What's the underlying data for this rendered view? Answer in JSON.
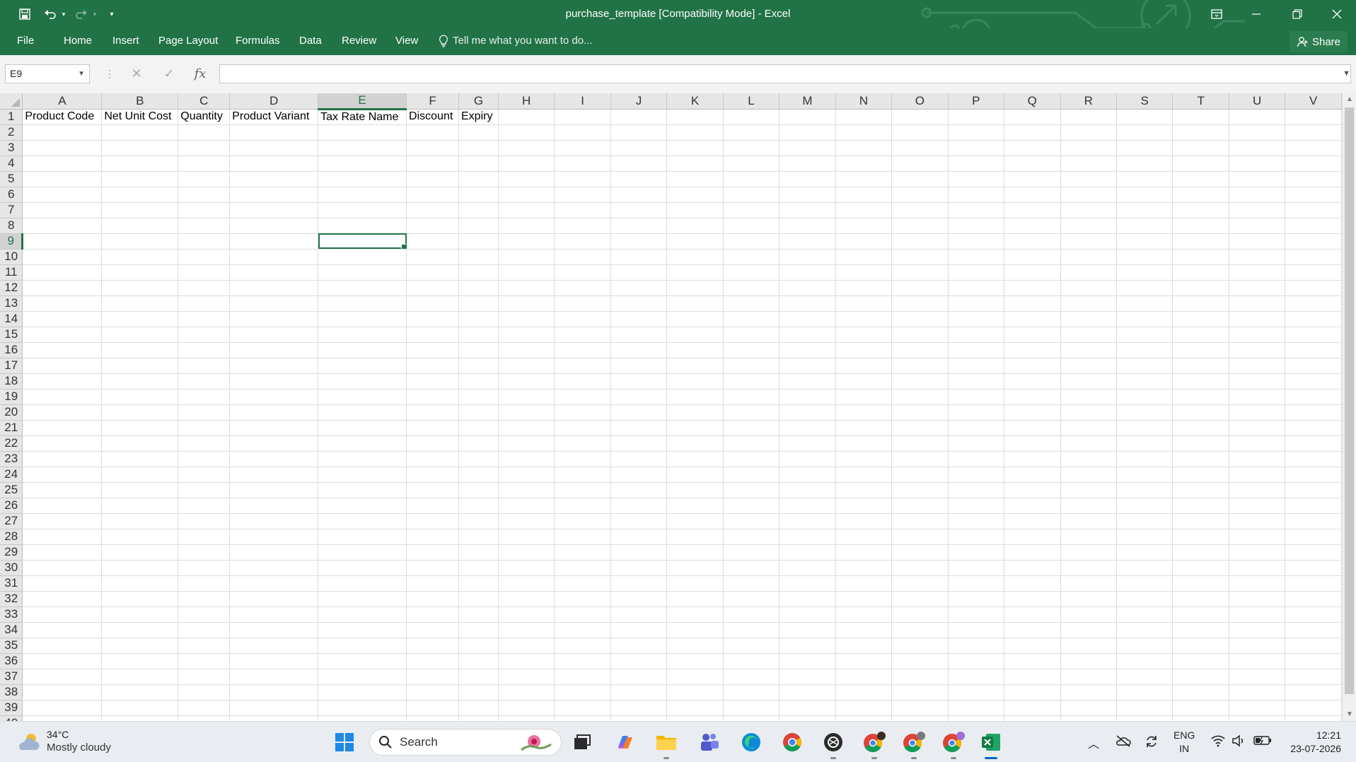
{
  "window": {
    "title": "purchase_template  [Compatibility Mode] - Excel"
  },
  "quick_access": {
    "save_icon": "save-icon",
    "undo_icon": "undo-icon",
    "redo_icon": "redo-icon",
    "customize_icon": "customize-qat-icon"
  },
  "ribbon": {
    "tabs": [
      "File",
      "Home",
      "Insert",
      "Page Layout",
      "Formulas",
      "Data",
      "Review",
      "View"
    ],
    "tell_me": "Tell me what you want to do...",
    "share_label": "Share"
  },
  "formula_bar": {
    "name_box": "E9",
    "fx_label": "fx",
    "formula": ""
  },
  "sheet": {
    "columns": [
      "A",
      "B",
      "C",
      "D",
      "E",
      "F",
      "G",
      "H",
      "I",
      "J",
      "K",
      "L",
      "M",
      "N",
      "O",
      "P",
      "Q",
      "R",
      "S",
      "T",
      "U",
      "V"
    ],
    "selected_column": "E",
    "selected_row": 9,
    "active_cell": "E9",
    "header_row": [
      "Product Code",
      "Net Unit Cost",
      "Quantity",
      "Product Variant",
      "Tax Rate Name",
      "Discount",
      "Expiry"
    ],
    "visible_rows_last": 39
  },
  "taskbar": {
    "weather_temp": "34°C",
    "weather_desc": "Mostly cloudy",
    "search_placeholder": "Search",
    "lang_top": "ENG",
    "lang_bottom": "IN",
    "time": "12:21",
    "date": "23-07-2026"
  },
  "colors": {
    "excel_green": "#217346",
    "taskbar_bg": "#e9edf2"
  }
}
